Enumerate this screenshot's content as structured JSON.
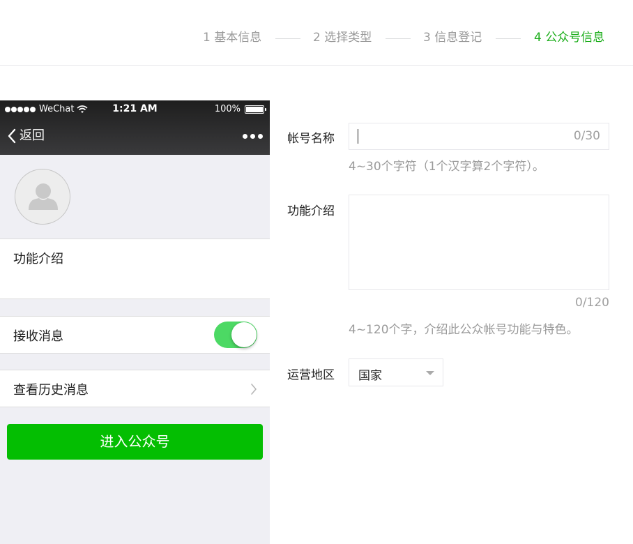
{
  "steps": [
    {
      "label": "1 基本信息"
    },
    {
      "label": "2 选择类型"
    },
    {
      "label": "3 信息登记"
    },
    {
      "label": "4 公众号信息"
    }
  ],
  "preview": {
    "status_bar": {
      "carrier": "WeChat",
      "time": "1:21 AM",
      "battery": "100%"
    },
    "nav": {
      "back_label": "返回",
      "more_icon": "more-dots-icon"
    },
    "avatar_icon": "avatar-placeholder-icon",
    "intro_label": "功能介绍",
    "receive_label": "接收消息",
    "receive_enabled": true,
    "history_label": "查看历史消息",
    "enter_button": "进入公众号"
  },
  "form": {
    "account_name": {
      "label": "帐号名称",
      "value": "",
      "counter": "0/30",
      "hint": "4~30个字符（1个汉字算2个字符）。"
    },
    "intro": {
      "label": "功能介绍",
      "value": "",
      "counter": "0/120",
      "hint": "4~120个字，介绍此公众帐号功能与特色。"
    },
    "region": {
      "label": "运营地区",
      "selected": "国家"
    }
  },
  "colors": {
    "active_step": "#1aad19",
    "toggle_on": "#4cd964",
    "enter_button_bg": "#04be02"
  }
}
